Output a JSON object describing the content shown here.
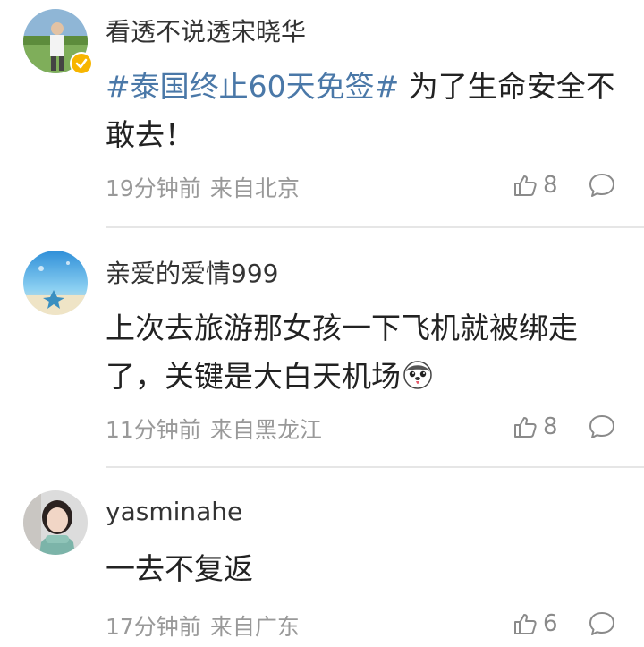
{
  "comments": [
    {
      "username": "看透不说透宋晓华",
      "hashtag": "#泰国终止60天免签#",
      "text": " 为了生命安全不敢去！",
      "time": "19分钟前",
      "location": "来自北京",
      "likes": "8",
      "verified": true
    },
    {
      "username": "亲爱的爱情999",
      "hashtag": "",
      "text": "上次去旅游那女孩一下飞机就被绑走了，关键是大白天机场",
      "time": "11分钟前",
      "location": "来自黑龙江",
      "likes": "8",
      "emoji": "husky-emoji"
    },
    {
      "username": "yasminahe",
      "hashtag": "",
      "text": "一去不复返",
      "time": "17分钟前",
      "location": "来自广东",
      "likes": "6"
    }
  ],
  "icons": {
    "like": "thumbs-up-icon",
    "reply": "comment-bubble-icon",
    "verified": "verified-badge-icon"
  },
  "colors": {
    "hashtag": "#4a78a8",
    "verified_badge": "#f7b500",
    "meta_text": "#999999"
  }
}
